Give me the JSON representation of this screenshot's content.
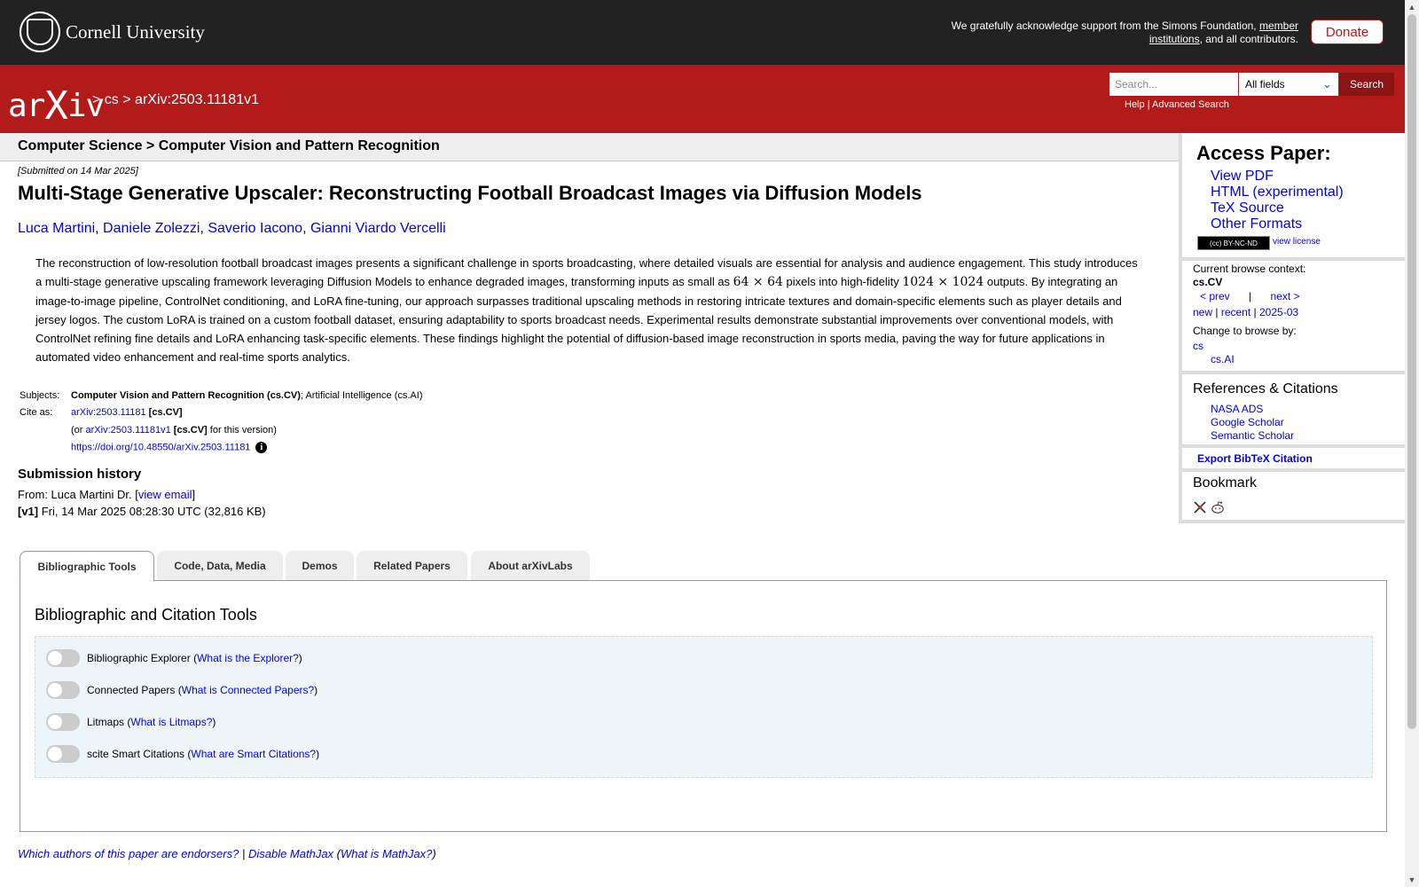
{
  "topbar": {
    "university": "Cornell University",
    "support_prefix": "We gratefully acknowledge support from the Simons Foundation,",
    "support_link": "member institutions",
    "support_suffix": ", and all contributors.",
    "donate": "Donate"
  },
  "header": {
    "logo_left": "ar",
    "logo_x": "X",
    "logo_right": "iv",
    "crumb_sep": ">",
    "crumb_cs": "cs",
    "crumb_id": "arXiv:2503.11181v1",
    "search_placeholder": "Search...",
    "search_field": "All fields",
    "search_button": "Search",
    "help": "Help",
    "pipe": "|",
    "advanced": "Advanced Search"
  },
  "subheader": "Computer Science > Computer Vision and Pattern Recognition",
  "paper": {
    "submitted": "[Submitted on 14 Mar 2025]",
    "title": "Multi-Stage Generative Upscaler: Reconstructing Football Broadcast Images via Diffusion Models",
    "authors": [
      "Luca Martini",
      "Daniele Zolezzi",
      "Saverio Iacono",
      "Gianni Viardo Vercelli"
    ],
    "abstract_1": "The reconstruction of low-resolution football broadcast images presents a significant challenge in sports broadcasting, where detailed visuals are essential for analysis and audience engagement. This study introduces a multi-stage generative upscaling framework leveraging Diffusion Models to enhance degraded images, transforming inputs as small as ",
    "math_1": "64 × 64",
    "abstract_2": " pixels into high-fidelity ",
    "math_2": "1024 × 1024",
    "abstract_3": " outputs. By integrating an image-to-image pipeline, ControlNet conditioning, and LoRA fine-tuning, our approach surpasses traditional upscaling methods in restoring intricate textures and domain-specific elements such as player details and jersey logos. The custom LoRA is trained on a custom football dataset, ensuring adaptability to sports broadcast needs. Experimental results demonstrate substantial improvements over conventional models, with ControlNet refining fine details and LoRA enhancing task-specific elements. These findings highlight the potential of diffusion-based image reconstruction in sports media, paving the way for future applications in automated video enhancement and real-time sports analytics.",
    "subjects_label": "Subjects:",
    "subjects_primary": "Computer Vision and Pattern Recognition (cs.CV)",
    "subjects_rest": "; Artificial Intelligence (cs.AI)",
    "cite_label": "Cite as:",
    "cite_id": "arXiv:2503.11181",
    "cite_cat": "[cs.CV]",
    "cite_or": "(or",
    "cite_v1": "arXiv:2503.11181v1",
    "cite_v1_cat": "[cs.CV]",
    "cite_version": "for this version)",
    "doi": "https://doi.org/10.48550/arXiv.2503.11181",
    "info_glyph": "i"
  },
  "history": {
    "title": "Submission history",
    "from_prefix": "From: Luca Martini Dr. [",
    "view_email": "view email",
    "from_suffix": "]",
    "v1_label": "[v1]",
    "v1_text": " Fri, 14 Mar 2025 08:28:30 UTC (32,816 KB)"
  },
  "sidebar": {
    "access_title": "Access Paper:",
    "access_links": [
      "View PDF",
      "HTML (experimental)",
      "TeX Source",
      "Other Formats"
    ],
    "cc_badge": "(cc) BY-NC-ND",
    "view_license": "view license",
    "browse_context": "Current browse context:",
    "context": "cs.CV",
    "prev": "< prev",
    "next": "next >",
    "new": "new",
    "recent": "recent",
    "month": "2025-03",
    "change_browse": "Change to browse by:",
    "browse_cs": "cs",
    "browse_ai": "cs.AI",
    "refs_title": "References & Citations",
    "refs": [
      "NASA ADS",
      "Google Scholar",
      "Semantic Scholar"
    ],
    "export_bibtex": "Export BibTeX Citation",
    "bookmark_title": "Bookmark"
  },
  "tabs": [
    "Bibliographic Tools",
    "Code, Data, Media",
    "Demos",
    "Related Papers",
    "About arXivLabs"
  ],
  "tools": {
    "title": "Bibliographic and Citation Tools",
    "items": [
      {
        "name": "Bibliographic Explorer",
        "link": "What is the Explorer?"
      },
      {
        "name": "Connected Papers",
        "link": "What is Connected Papers?"
      },
      {
        "name": "Litmaps",
        "link": "What is Litmaps?"
      },
      {
        "name": "scite Smart Citations",
        "link": "What are Smart Citations?"
      }
    ]
  },
  "footer": {
    "endorsers": "Which authors of this paper are endorsers?",
    "disable_mathjax": "Disable MathJax",
    "what_mathjax": "What is MathJax?"
  },
  "icons": {
    "scroll_up": "▲",
    "scroll_down": "▼",
    "select_chevron": "⌄"
  },
  "colors": {
    "arxiv_red": "#b31b1b",
    "link_blue": "#0000ee",
    "dark_bar": "#222222"
  }
}
